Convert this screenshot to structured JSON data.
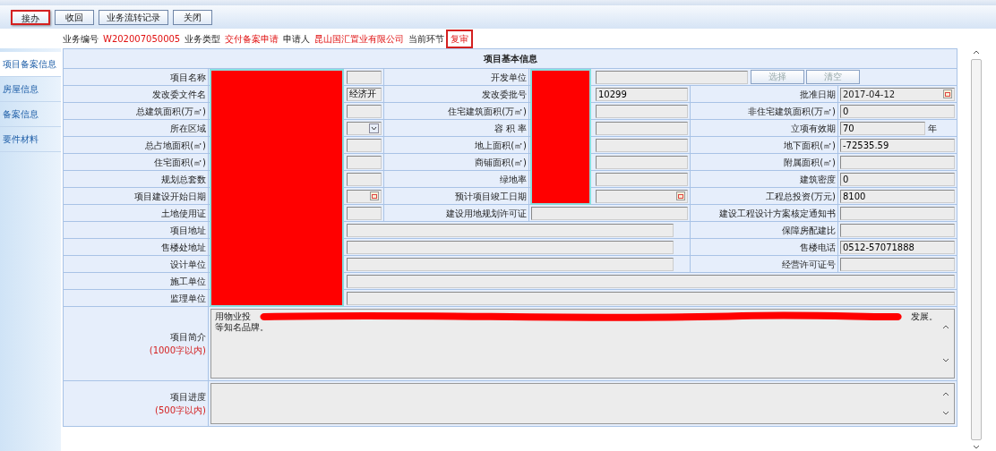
{
  "toolbar": {
    "buttons": [
      {
        "label": "接办",
        "highlighted": true
      },
      {
        "label": "收回",
        "highlighted": false
      },
      {
        "label": "业务流转记录",
        "highlighted": false
      },
      {
        "label": "关闭",
        "highlighted": false
      }
    ]
  },
  "info": [
    {
      "label": "业务编号",
      "value": "W202007050005",
      "highlighted": false
    },
    {
      "label": "业务类型",
      "value": "交付备案申请",
      "highlighted": false
    },
    {
      "label": "申请人",
      "value": "昆山国汇置业有限公司",
      "highlighted": false
    },
    {
      "label": "当前环节",
      "value": "复审",
      "highlighted": true
    }
  ],
  "sidebar": {
    "items": [
      {
        "label": "项目备案信息",
        "selected": true
      },
      {
        "label": "房屋信息",
        "selected": false
      },
      {
        "label": "备案信息",
        "selected": false
      },
      {
        "label": "要件材料",
        "selected": false
      }
    ]
  },
  "form": {
    "title": "项目基本信息",
    "rows": [
      [
        {
          "kind": "label",
          "text": "项目名称"
        },
        {
          "kind": "text",
          "redacted": true
        },
        {
          "kind": "label",
          "text": "开发单位"
        },
        {
          "kind": "picker",
          "colspan": 3,
          "redacted": true,
          "buttons": [
            {
              "label": "选择",
              "disabled": true
            },
            {
              "label": "清空",
              "disabled": true
            }
          ]
        }
      ],
      [
        {
          "kind": "label",
          "text": "发改委文件名"
        },
        {
          "kind": "text",
          "value": "经济开",
          "redacted": true
        },
        {
          "kind": "label",
          "text": "发改委批号"
        },
        {
          "kind": "text",
          "value": "10299",
          "redacted": true
        },
        {
          "kind": "label",
          "text": "批准日期"
        },
        {
          "kind": "date",
          "value": "2017-04-12"
        }
      ],
      [
        {
          "kind": "label",
          "text": "总建筑面积(万㎡)"
        },
        {
          "kind": "text",
          "redacted": true
        },
        {
          "kind": "label",
          "text": "住宅建筑面积(万㎡)"
        },
        {
          "kind": "text",
          "redacted": true
        },
        {
          "kind": "label",
          "text": "非住宅建筑面积(万㎡)"
        },
        {
          "kind": "text",
          "value": "0"
        }
      ],
      [
        {
          "kind": "label",
          "text": "所在区域"
        },
        {
          "kind": "select",
          "redacted": true
        },
        {
          "kind": "label",
          "text": "容 积 率"
        },
        {
          "kind": "text",
          "redacted": true
        },
        {
          "kind": "label",
          "text": "立项有效期"
        },
        {
          "kind": "unit",
          "value": "70",
          "unit": "年"
        }
      ],
      [
        {
          "kind": "label",
          "text": "总占地面积(㎡)"
        },
        {
          "kind": "text",
          "redacted": true
        },
        {
          "kind": "label",
          "text": "地上面积(㎡)"
        },
        {
          "kind": "text",
          "redacted": true
        },
        {
          "kind": "label",
          "text": "地下面积(㎡)"
        },
        {
          "kind": "text",
          "value": "-72535.59"
        }
      ],
      [
        {
          "kind": "label",
          "text": "住宅面积(㎡)"
        },
        {
          "kind": "text",
          "redacted": true
        },
        {
          "kind": "label",
          "text": "商铺面积(㎡)"
        },
        {
          "kind": "text",
          "redacted": true
        },
        {
          "kind": "label",
          "text": "附属面积(㎡)"
        },
        {
          "kind": "text"
        }
      ],
      [
        {
          "kind": "label",
          "text": "规划总套数"
        },
        {
          "kind": "text",
          "redacted": true
        },
        {
          "kind": "label",
          "text": "绿地率"
        },
        {
          "kind": "text",
          "redacted": true
        },
        {
          "kind": "label",
          "text": "建筑密度"
        },
        {
          "kind": "text",
          "value": "0"
        }
      ],
      [
        {
          "kind": "label",
          "text": "项目建设开始日期"
        },
        {
          "kind": "date",
          "redacted": true
        },
        {
          "kind": "label",
          "text": "预计项目竣工日期"
        },
        {
          "kind": "date",
          "redacted": true
        },
        {
          "kind": "label",
          "text": "工程总投资(万元)"
        },
        {
          "kind": "text",
          "value": "8100"
        }
      ],
      [
        {
          "kind": "label",
          "text": "土地使用证"
        },
        {
          "kind": "text",
          "redacted": true
        },
        {
          "kind": "label",
          "text": "建设用地规划许可证"
        },
        {
          "kind": "text"
        },
        {
          "kind": "label",
          "text": "建设工程设计方案核定通知书"
        },
        {
          "kind": "text"
        }
      ],
      [
        {
          "kind": "label",
          "text": "项目地址"
        },
        {
          "kind": "text",
          "colspan": 3,
          "redacted": true
        },
        {
          "kind": "label",
          "text": "保障房配建比"
        },
        {
          "kind": "text"
        }
      ],
      [
        {
          "kind": "label",
          "text": "售楼处地址"
        },
        {
          "kind": "text",
          "colspan": 3,
          "redacted": true
        },
        {
          "kind": "label",
          "text": "售楼电话"
        },
        {
          "kind": "text",
          "value": "0512-57071888"
        }
      ],
      [
        {
          "kind": "label",
          "text": "设计单位"
        },
        {
          "kind": "text",
          "colspan": 3,
          "redacted": true
        },
        {
          "kind": "label",
          "text": "经营许可证号"
        },
        {
          "kind": "text"
        }
      ],
      [
        {
          "kind": "label",
          "text": "施工单位"
        },
        {
          "kind": "text",
          "colspan": 5,
          "redacted": true
        }
      ],
      [
        {
          "kind": "label",
          "text": "监理单位"
        },
        {
          "kind": "text",
          "colspan": 5,
          "redacted": true
        }
      ],
      [
        {
          "kind": "label",
          "text": "项目简介",
          "note": "(1000字以内)"
        },
        {
          "kind": "textarea",
          "colspan": 5,
          "lines": [
            {
              "left": "用物业投",
              "right": "发展。"
            },
            {
              "left": "等知名品牌。"
            }
          ]
        }
      ],
      [
        {
          "kind": "label",
          "text": "项目进度",
          "note": "(500字以内)"
        },
        {
          "kind": "textarea",
          "colspan": 5
        }
      ]
    ]
  },
  "redactions": [
    {
      "kind": "block"
    },
    {
      "kind": "block"
    },
    {
      "kind": "scribble"
    }
  ]
}
